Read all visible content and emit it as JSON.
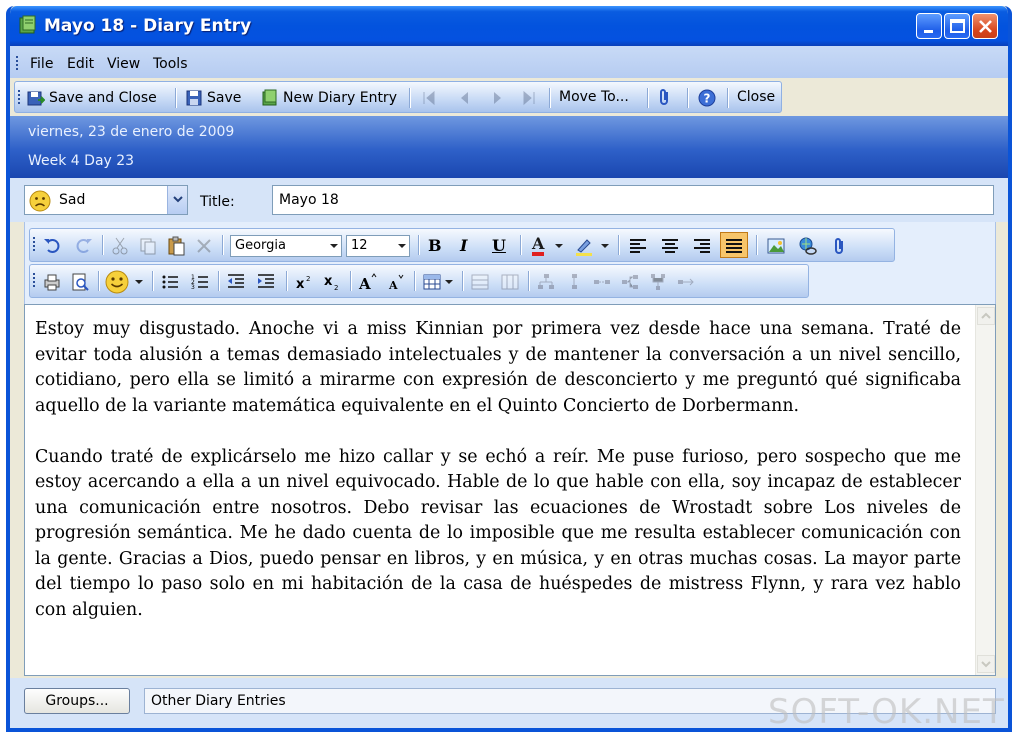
{
  "window": {
    "title": "Mayo 18 - Diary Entry"
  },
  "menu": {
    "items": [
      "File",
      "Edit",
      "View",
      "Tools"
    ]
  },
  "toolbar": {
    "save_close": "Save and Close",
    "save": "Save",
    "new_entry": "New Diary Entry",
    "move_to": "Move To...",
    "close": "Close"
  },
  "entry_info": {
    "date": "viernes, 23 de enero de 2009",
    "week": "Week 4 Day 23"
  },
  "mood": {
    "value": "Sad",
    "icon": "sad-face-icon"
  },
  "title_field": {
    "label": "Title:",
    "value": "Mayo 18"
  },
  "format_bar": {
    "font": "Georgia",
    "size": "12",
    "bold": "B",
    "italic": "I",
    "underline": "U",
    "font_color": "A",
    "active_align": "justify"
  },
  "body": {
    "paragraphs": [
      "Estoy muy disgustado. Anoche vi a miss Kinnian por primera vez desde hace una semana. Traté de evitar toda alusión a temas demasiado intelectuales y de mantener la conversación a un nivel sencillo, cotidiano, pero ella se limitó a mirarme con expresión de desconcierto y me preguntó qué significaba aquello de la variante matemática equivalente en el Quinto Concierto de Dorbermann.",
      "Cuando traté de explicárselo me hizo callar y se echó a reír. Me puse furioso, pero sospecho que me estoy acercando a ella a un nivel equivocado. Hable de lo que hable con ella, soy incapaz de establecer una comunicación entre nosotros. Debo revisar las ecuaciones de Wrostadt sobre Los niveles de progresión semántica. Me he dado cuenta de lo imposible que me resulta establecer comunicación con la gente. Gracias a Dios, puedo pensar en libros, y en música, y en otras muchas cosas. La mayor parte del tiempo lo paso solo en mi habitación de la casa de huéspedes de mistress Flynn, y rara vez hablo con alguien."
    ]
  },
  "footer": {
    "groups_button": "Groups...",
    "other_entries": "Other Diary Entries"
  },
  "watermark": "SOFT-OK.NET",
  "colors": {
    "titlebar": "#0353de",
    "close_button": "#d6451c",
    "info_band": "#2e60c8",
    "active_button": "#f7c56a"
  }
}
